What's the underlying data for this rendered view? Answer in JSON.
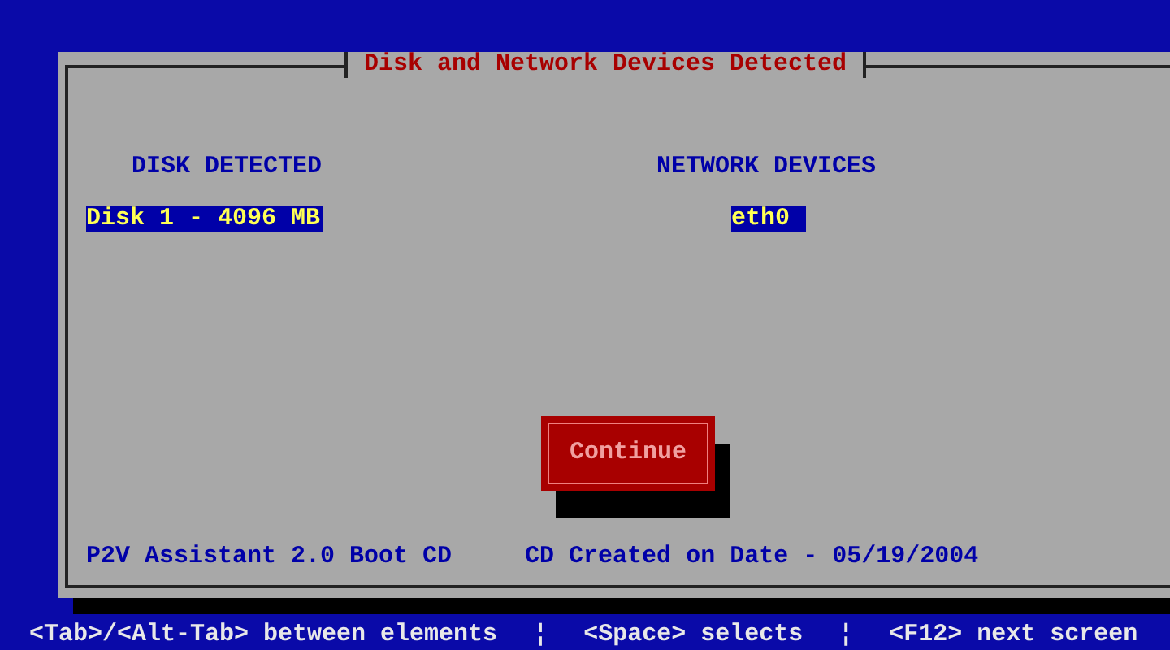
{
  "dialog": {
    "title": "Disk and Network Devices Detected"
  },
  "disks": {
    "heading": "DISK DETECTED",
    "items": [
      {
        "label": "Disk 1 - 4096 MB",
        "selected": true
      }
    ]
  },
  "network": {
    "heading": "NETWORK DEVICES",
    "items": [
      {
        "label": "eth0",
        "selected": true
      }
    ]
  },
  "button": {
    "label": "Continue"
  },
  "footer": [
    "P2V Assistant 2.0 Boot CD",
    "CD Created on Date - 05/19/2004"
  ],
  "status_bar": [
    "<Tab>/<Alt-Tab> between elements",
    "¦",
    "<Space> selects",
    "¦",
    "<F12> next screen"
  ]
}
